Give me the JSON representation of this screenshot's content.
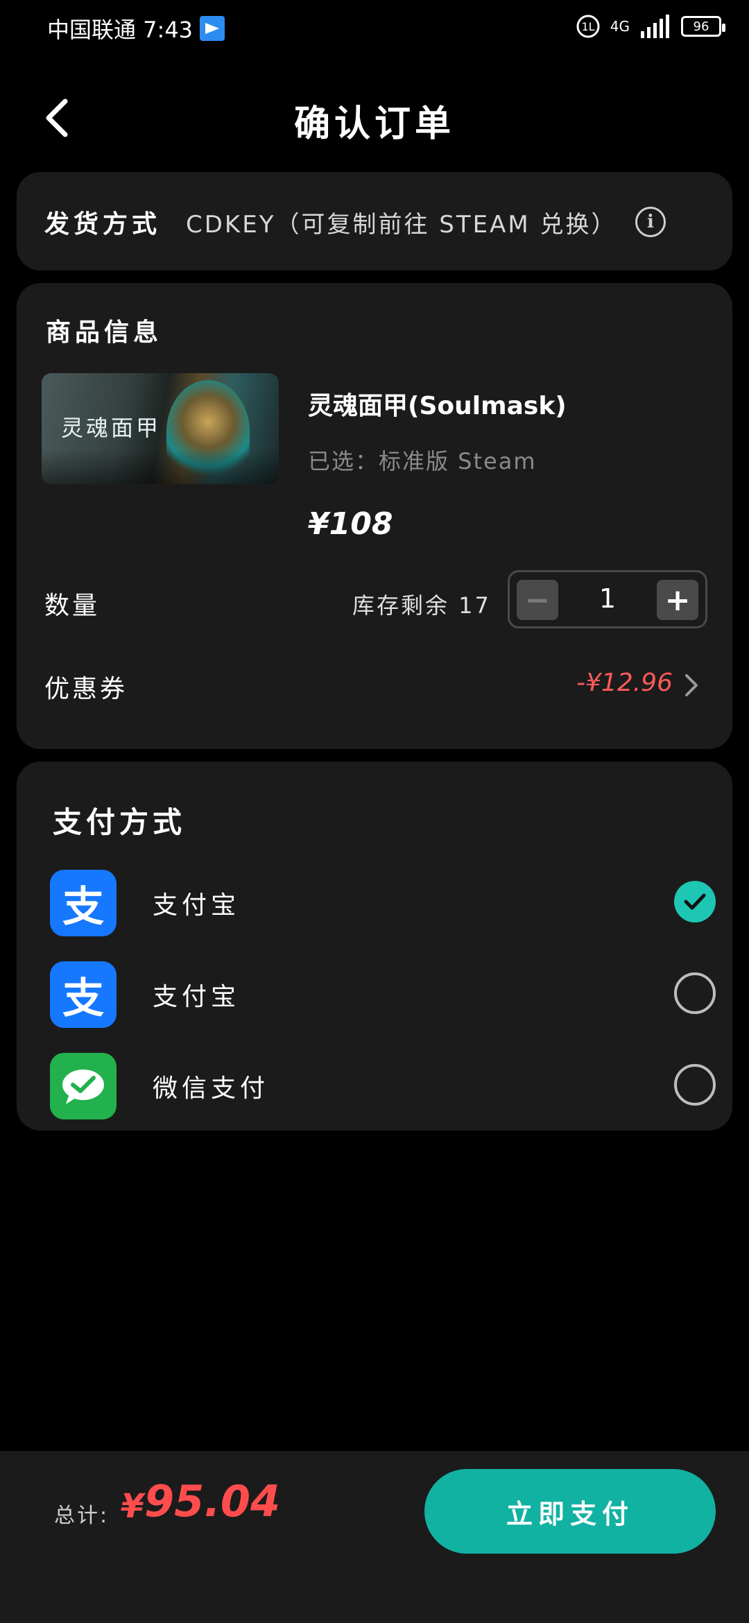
{
  "status_bar": {
    "carrier_time": "中国联通 7:43",
    "network": "4G",
    "battery": "96"
  },
  "nav": {
    "title": "确认订单"
  },
  "delivery": {
    "label": "发货方式",
    "value": "CDKEY（可复制前往 STEAM 兑换）"
  },
  "goods": {
    "section_title": "商品信息",
    "cover_title": "灵魂面甲",
    "name": "灵魂面甲(Soulmask)",
    "variant": "已选：标准版 Steam",
    "price": "¥108",
    "quantity_label": "数量",
    "stock": "库存剩余 17",
    "quantity": "1",
    "minus": "−",
    "plus": "+",
    "coupon_label": "优惠券",
    "coupon_value": "-¥12.96"
  },
  "payment": {
    "section_title": "支付方式",
    "methods": [
      {
        "name": "支付宝",
        "icon": "alipay-icon",
        "icon_text": "支",
        "selected": true
      },
      {
        "name": "支付宝",
        "icon": "alipay-icon",
        "icon_text": "支",
        "selected": false
      },
      {
        "name": "微信支付",
        "icon": "wechat-pay-icon",
        "selected": false
      }
    ]
  },
  "footer": {
    "total_label": "总计:",
    "currency": "¥",
    "total_amount": "95.04",
    "pay_button": "立即支付"
  },
  "colors": {
    "accent": "#12b2a3",
    "price_red": "#ff4d4d",
    "card_bg": "#1b1b1b"
  }
}
